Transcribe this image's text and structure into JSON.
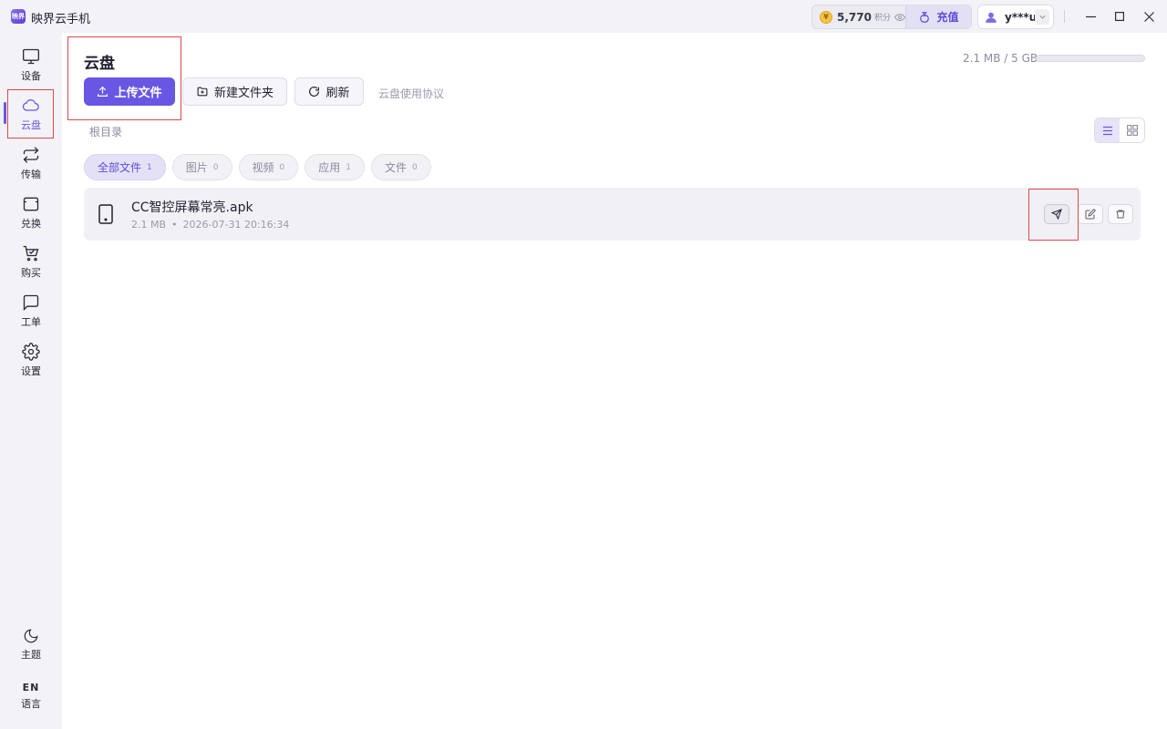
{
  "app": {
    "title": "映界云手机",
    "logo_text": "映界"
  },
  "header": {
    "points_value": "5,770",
    "points_unit": "积分",
    "recharge_label": "充值",
    "username": "y***u"
  },
  "sidebar": {
    "items": [
      {
        "label": "设备",
        "icon": "monitor-icon"
      },
      {
        "label": "云盘",
        "icon": "cloud-icon",
        "active": true
      },
      {
        "label": "传输",
        "icon": "transfer-icon"
      },
      {
        "label": "兑换",
        "icon": "ticket-icon"
      },
      {
        "label": "购买",
        "icon": "cart-icon"
      },
      {
        "label": "工单",
        "icon": "chat-icon"
      },
      {
        "label": "设置",
        "icon": "gear-icon"
      }
    ],
    "bottom": {
      "theme_label": "主题",
      "lang_code": "EN",
      "lang_label": "语言"
    }
  },
  "main": {
    "page_title": "云盘",
    "upload_label": "上传文件",
    "new_folder_label": "新建文件夹",
    "refresh_label": "刷新",
    "agreement_label": "云盘使用协议",
    "storage_text": "2.1 MB / 5 GB",
    "storage_fraction": 0.0004,
    "breadcrumb": "根目录",
    "filters": [
      {
        "label": "全部文件",
        "count": "1",
        "active": true
      },
      {
        "label": "图片",
        "count": "0"
      },
      {
        "label": "视频",
        "count": "0"
      },
      {
        "label": "应用",
        "count": "1"
      },
      {
        "label": "文件",
        "count": "0"
      }
    ],
    "files": [
      {
        "name": "CC智控屏幕常亮.apk",
        "size": "2.1 MB",
        "separator": "•",
        "date": "2026-07-31 20:16:34"
      }
    ]
  },
  "colors": {
    "accent": "#6757e3",
    "highlight_box": "#e0474c"
  }
}
